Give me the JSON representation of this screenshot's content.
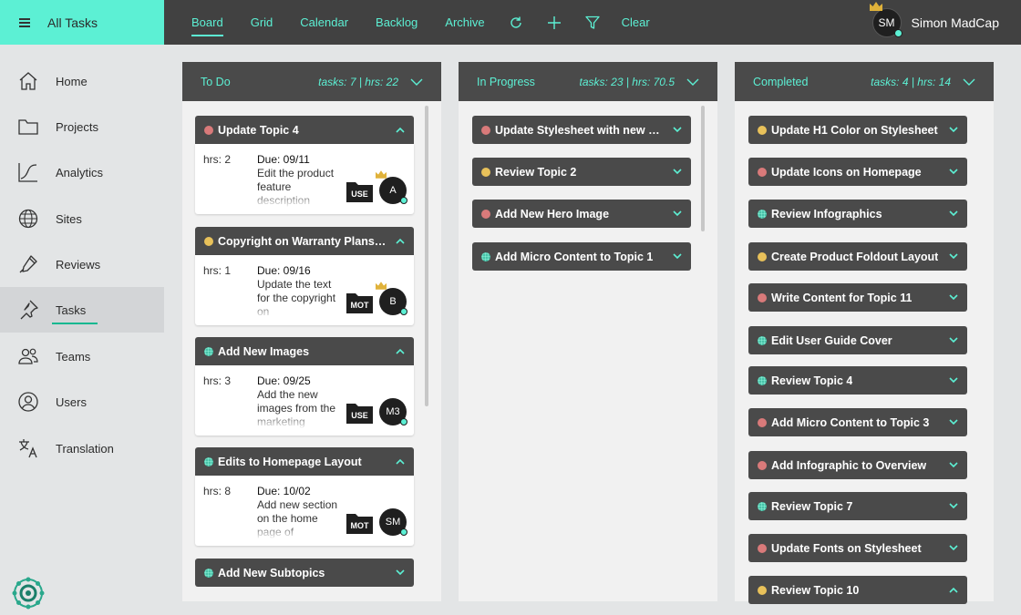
{
  "brand": {
    "title": "All Tasks"
  },
  "nav": {
    "items": [
      "Board",
      "Grid",
      "Calendar",
      "Backlog",
      "Archive"
    ],
    "clear": "Clear"
  },
  "user": {
    "initials": "SM",
    "name": "Simon MadCap"
  },
  "sidebar": {
    "items": [
      "Home",
      "Projects",
      "Analytics",
      "Sites",
      "Reviews",
      "Tasks",
      "Teams",
      "Users",
      "Translation"
    ]
  },
  "colors": {
    "accent": "#5cf0d4",
    "header": "#414141",
    "red": "#d97a7a",
    "yellow": "#e8c15a",
    "teal": "#35b59a"
  },
  "columns": [
    {
      "title": "To Do",
      "stats": "tasks: 7 | hrs: 22"
    },
    {
      "title": "In Progress",
      "stats": "tasks: 23 | hrs: 70.5"
    },
    {
      "title": "Completed",
      "stats": "tasks: 4 | hrs: 14"
    }
  ],
  "todo": [
    {
      "title": "Update Topic 4",
      "status": "red",
      "hrs": "hrs: 2",
      "due": "Due: 09/11",
      "desc": "Edit the product feature description",
      "folder": "USE",
      "avatar": "A",
      "crown": true
    },
    {
      "title": "Copyright on Warranty Plans B...",
      "status": "yellow",
      "hrs": "hrs: 1",
      "due": "Due: 09/16",
      "desc": "Update the text for the copyright on",
      "folder": "MOT",
      "avatar": "B",
      "crown": true
    },
    {
      "title": "Add New Images",
      "status": "teal",
      "hrs": "hrs: 3",
      "due": "Due: 09/25",
      "desc": "Add the new images from the marketing",
      "folder": "USE",
      "avatar": "M3",
      "crown": false
    },
    {
      "title": "Edits to Homepage Layout",
      "status": "teal",
      "hrs": "hrs: 8",
      "due": "Due: 10/02",
      "desc": "Add new section on the home page of",
      "folder": "MOT",
      "avatar": "SM",
      "crown": false
    },
    {
      "title": "Add New Subtopics",
      "status": "teal"
    }
  ],
  "inprogress": [
    {
      "title": "Update Stylesheet with new Br...",
      "status": "red"
    },
    {
      "title": "Review Topic 2",
      "status": "yellow"
    },
    {
      "title": "Add New Hero Image",
      "status": "red"
    },
    {
      "title": "Add Micro Content to Topic 1",
      "status": "teal"
    }
  ],
  "completed": [
    {
      "title": "Update H1 Color on Stylesheet",
      "status": "yellow"
    },
    {
      "title": "Update Icons on Homepage",
      "status": "red"
    },
    {
      "title": "Review Infographics",
      "status": "teal"
    },
    {
      "title": "Create Product Foldout Layout",
      "status": "yellow"
    },
    {
      "title": "Write Content for Topic 11",
      "status": "red"
    },
    {
      "title": "Edit User Guide Cover",
      "status": "teal"
    },
    {
      "title": "Review Topic 4",
      "status": "teal"
    },
    {
      "title": "Add Micro Content to Topic 3",
      "status": "red"
    },
    {
      "title": "Add Infographic to Overview",
      "status": "red"
    },
    {
      "title": "Review Topic 7",
      "status": "teal"
    },
    {
      "title": "Update Fonts on Stylesheet",
      "status": "red"
    },
    {
      "title": "Review Topic 10",
      "status": "yellow"
    }
  ]
}
